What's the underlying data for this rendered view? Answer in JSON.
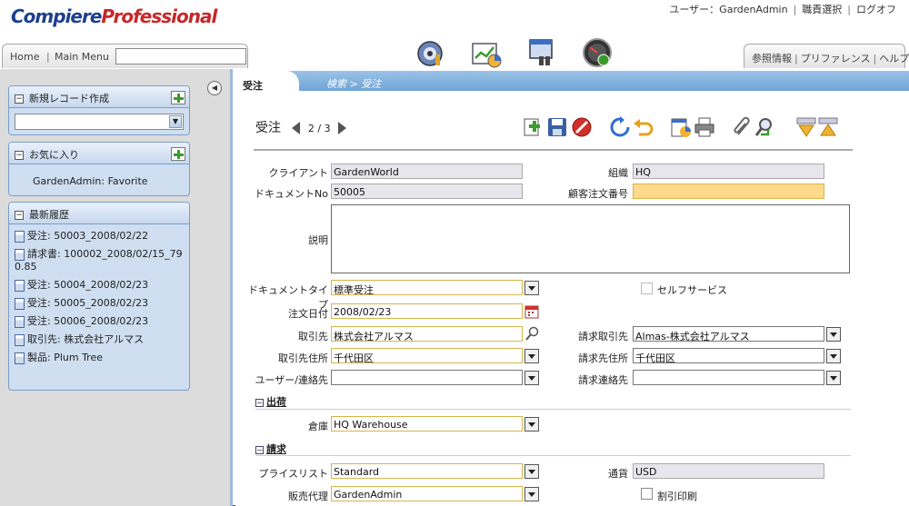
{
  "header": {
    "logo_part1": "Compiere",
    "logo_part2": "Professional",
    "top_links": [
      "ユーザー：GardenAdmin",
      "職責選択",
      "ログオフ"
    ],
    "nav_home": "Home",
    "nav_main_menu": "Main Menu",
    "search_value": "",
    "right_links": [
      "参照情報",
      "プリファレンス",
      "ヘルプ"
    ],
    "icons": [
      "performance-icon",
      "chart-icon",
      "window-search-icon",
      "dashboard-gauge-icon"
    ]
  },
  "sidebar": {
    "new_record": {
      "title": "新規レコード作成",
      "select_value": ""
    },
    "favorites": {
      "title": "お気に入り",
      "items": [
        "GardenAdmin: Favorite"
      ]
    },
    "recent": {
      "title": "最新履歴",
      "items": [
        "受注: 50003_2008/02/22",
        "請求書: 100002_2008/02/15_790.85",
        "受注: 50004_2008/02/23",
        "受注: 50005_2008/02/23",
        "受注: 50006_2008/02/23",
        "取引先: 株式会社アルマス",
        "製品: Plum Tree"
      ]
    }
  },
  "tabs": {
    "active": "受注",
    "breadcrumb": "検索 >  受注"
  },
  "form": {
    "title": "受注",
    "record_pos": "2 / 3",
    "toolbar": [
      "new-record-icon",
      "save-icon",
      "delete-icon",
      "refresh-icon",
      "undo-icon",
      "report-icon",
      "print-icon",
      "attachment-icon",
      "zoom-icon",
      "down-icon",
      "up-icon"
    ],
    "fields": {
      "client_label": "クライアント",
      "client_value": "GardenWorld",
      "org_label": "組織",
      "org_value": "HQ",
      "docno_label": "ドキュメントNo",
      "docno_value": "50005",
      "po_label": "顧客注文番号",
      "po_value": "",
      "desc_label": "説明",
      "desc_value": "",
      "doctype_label": "ドキュメントタイプ",
      "doctype_value": "標準受注",
      "selfservice_label": "セルフサービス",
      "orderdate_label": "注文日付",
      "orderdate_value": "2008/02/23",
      "bp_label": "取引先",
      "bp_value": "株式会社アルマス",
      "billbp_label": "請求取引先",
      "billbp_value": "Almas-株式会社アルマス",
      "bploc_label": "取引先住所",
      "bploc_value": "千代田区",
      "billloc_label": "請求先住所",
      "billloc_value": "千代田区",
      "contact_label": "ユーザー/連絡先",
      "contact_value": "",
      "billcontact_label": "請求連絡先",
      "billcontact_value": ""
    },
    "shipping": {
      "section": "出荷",
      "warehouse_label": "倉庫",
      "warehouse_value": "HQ Warehouse"
    },
    "billing": {
      "section": "請求",
      "pricelist_label": "プライスリスト",
      "pricelist_value": "Standard",
      "currency_label": "通貨",
      "currency_value": "USD",
      "salesrep_label": "販売代理",
      "salesrep_value": "GardenAdmin",
      "discount_label": "割引印刷"
    }
  }
}
